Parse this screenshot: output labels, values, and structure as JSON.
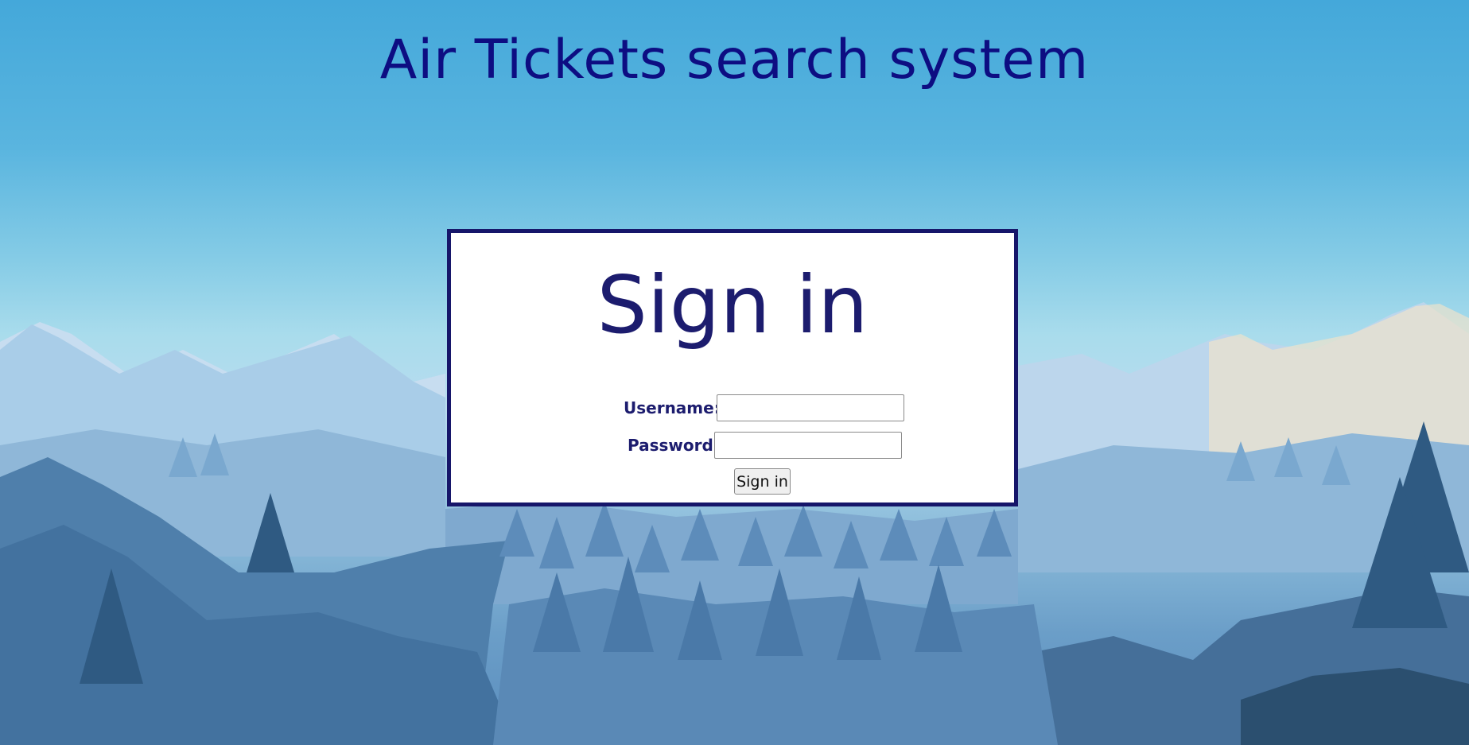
{
  "page": {
    "title": "Air Tickets search system"
  },
  "signin": {
    "heading": "Sign in",
    "username_label": "Username:",
    "username_value": "",
    "password_label": "Password:",
    "password_value": "",
    "submit_label": "Sign in"
  },
  "colors": {
    "title": "#0d0d82",
    "card_border": "#16166a",
    "card_text": "#1c1c6e",
    "card_bg": "#ffffff"
  }
}
